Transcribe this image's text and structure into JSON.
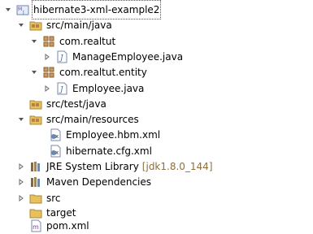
{
  "tree": {
    "project": {
      "label": "hibernate3-xml-example2"
    },
    "src_main_java": {
      "label": "src/main/java"
    },
    "pkg_com_realtut": {
      "label": "com.realtut"
    },
    "manage_employee": {
      "label": "ManageEmployee.java"
    },
    "pkg_entity": {
      "label": "com.realtut.entity"
    },
    "employee_java": {
      "label": "Employee.java"
    },
    "src_test_java": {
      "label": "src/test/java"
    },
    "src_main_resources": {
      "label": "src/main/resources"
    },
    "employee_hbm": {
      "label": "Employee.hbm.xml"
    },
    "hibernate_cfg": {
      "label": "hibernate.cfg.xml"
    },
    "jre_library": {
      "label": "JRE System Library",
      "decoration": "[jdk1.8.0_144]"
    },
    "maven_deps": {
      "label": "Maven Dependencies"
    },
    "src": {
      "label": "src"
    },
    "target": {
      "label": "target"
    },
    "pom": {
      "label": "pom.xml"
    }
  },
  "colors": {
    "decoration": "#8a6f3f",
    "package": "#b5834a",
    "folder": "#e8c15b",
    "java": "#4b6ea8"
  }
}
